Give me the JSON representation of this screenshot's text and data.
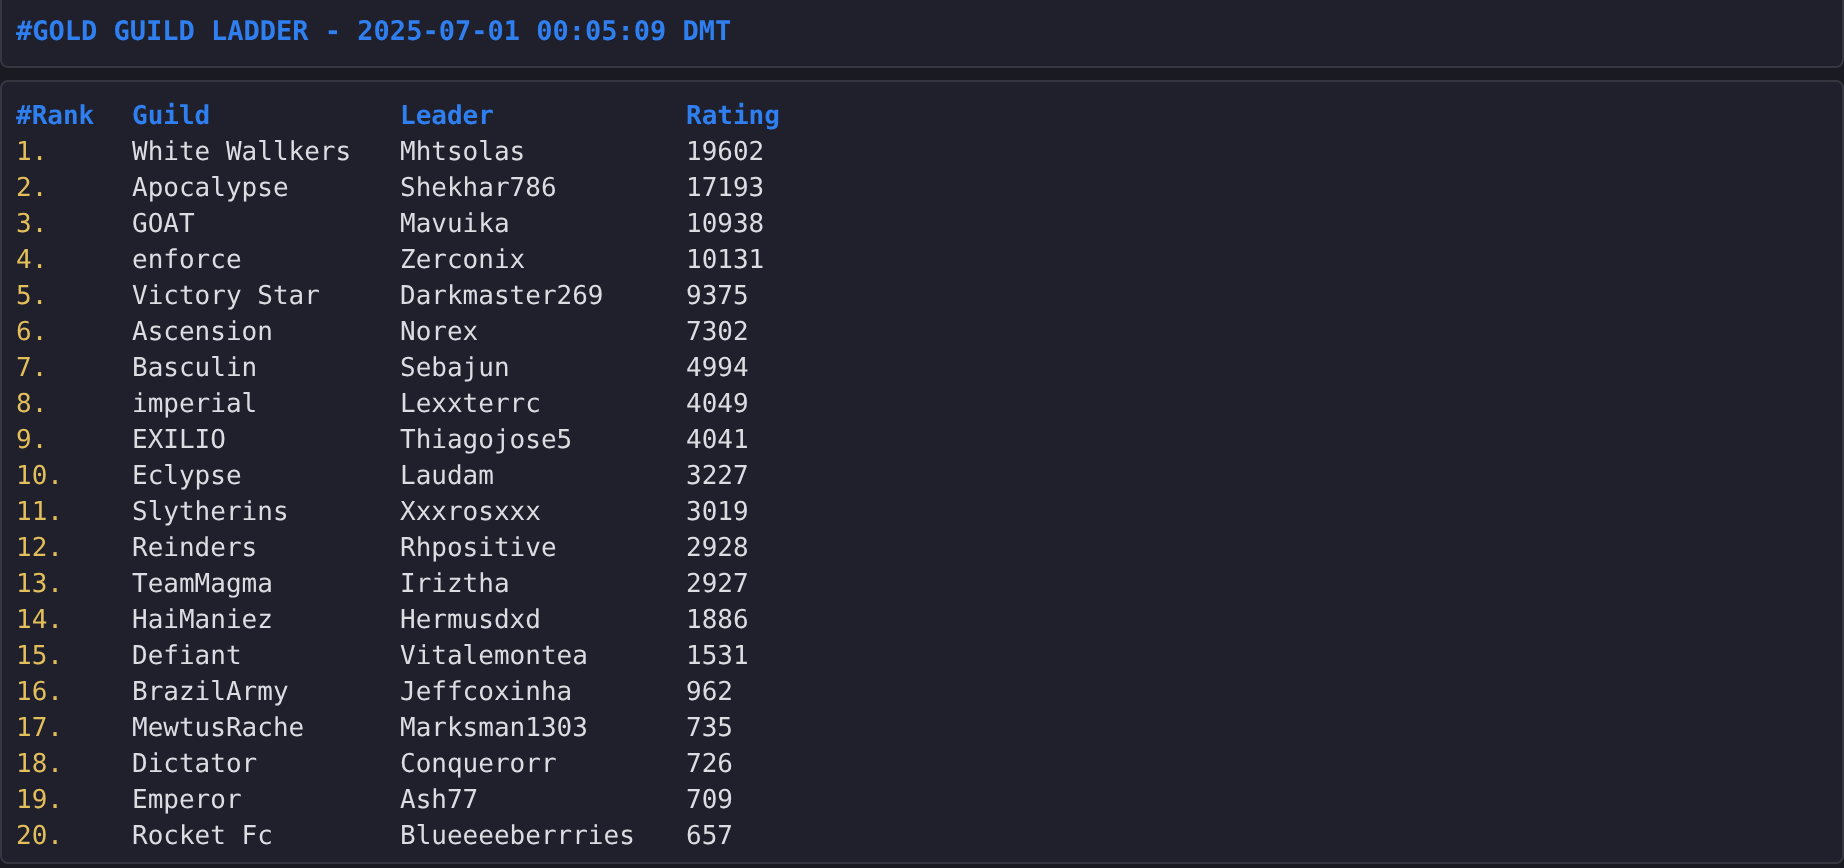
{
  "title": "#GOLD GUILD LADDER - 2025-07-01 00:05:09 DMT",
  "table": {
    "columns": [
      "#Rank",
      "Guild",
      "Leader",
      "Rating"
    ],
    "rows": [
      [
        "1.",
        "White Wallkers",
        "Mhtsolas",
        "19602"
      ],
      [
        "2.",
        "Apocalypse",
        "Shekhar786",
        "17193"
      ],
      [
        "3.",
        "GOAT",
        "Mavuika",
        "10938"
      ],
      [
        "4.",
        "enforce",
        "Zerconix",
        "10131"
      ],
      [
        "5.",
        "Victory Star",
        "Darkmaster269",
        "9375"
      ],
      [
        "6.",
        "Ascension",
        "Norex",
        "7302"
      ],
      [
        "7.",
        "Basculin",
        "Sebajun",
        "4994"
      ],
      [
        "8.",
        "imperial",
        "Lexxterrc",
        "4049"
      ],
      [
        "9.",
        "EXILIO",
        "Thiagojose5",
        "4041"
      ],
      [
        "10.",
        "Eclypse",
        "Laudam",
        "3227"
      ],
      [
        "11.",
        "Slytherins",
        "Xxxrosxxx",
        "3019"
      ],
      [
        "12.",
        "Reinders",
        "Rhpositive",
        "2928"
      ],
      [
        "13.",
        "TeamMagma",
        "Iriztha",
        "2927"
      ],
      [
        "14.",
        "HaiManiez",
        "Hermusdxd",
        "1886"
      ],
      [
        "15.",
        "Defiant",
        "Vitalemontea",
        "1531"
      ],
      [
        "16.",
        "BrazilArmy",
        "Jeffcoxinha",
        "962"
      ],
      [
        "17.",
        "MewtusRache",
        "Marksman1303",
        "735"
      ],
      [
        "18.",
        "Dictator",
        "Conquerorr",
        "726"
      ],
      [
        "19.",
        "Emperor",
        "Ash77",
        "709"
      ],
      [
        "20.",
        "Rocket Fc",
        "Blueeeeberrries",
        "657"
      ]
    ]
  }
}
